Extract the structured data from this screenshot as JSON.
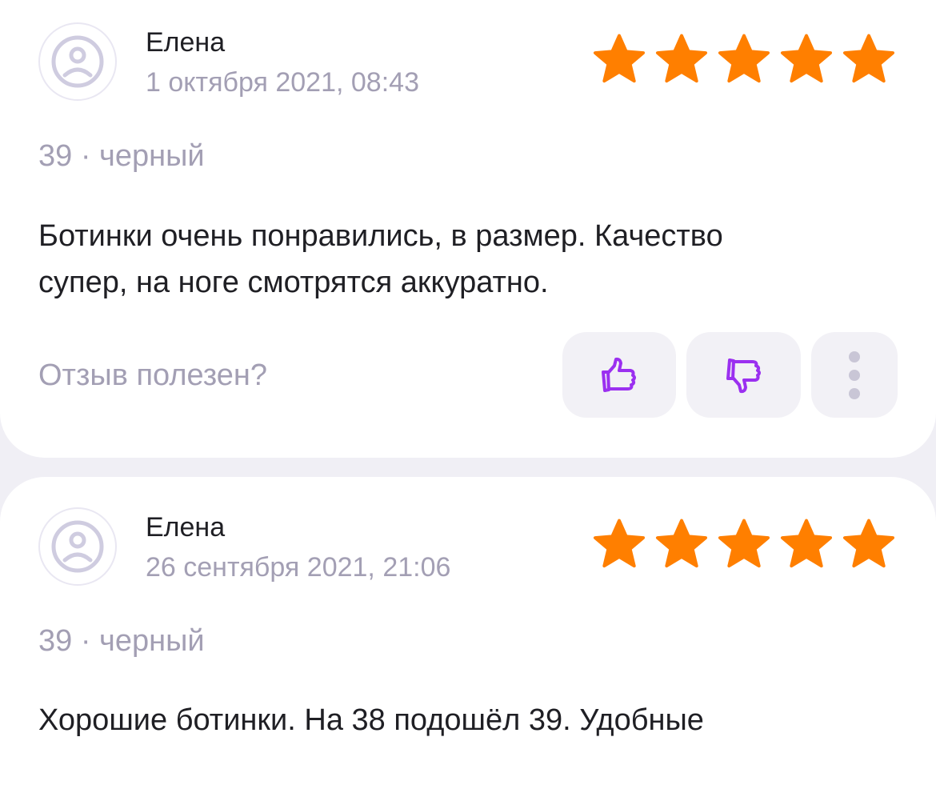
{
  "colors": {
    "star": "#ff7f00",
    "accent": "#9b30f0",
    "muted": "#a39fb4",
    "text": "#1f1f24"
  },
  "reviews": [
    {
      "author": "Елена",
      "date": "1 октября 2021, 08:43",
      "rating": 5,
      "variant": "39 · черный",
      "text_lines": [
        "Ботинки очень понравились, в размер. Качество",
        "супер, на ноге смотрятся аккуратно."
      ],
      "helpful_prompt": "Отзыв полезен?",
      "icons": {
        "avatar": "user-sad-face-icon",
        "like": "thumbs-up-icon",
        "dislike": "thumbs-down-icon",
        "more": "more-vertical-icon"
      }
    },
    {
      "author": "Елена",
      "date": "26 сентября 2021, 21:06",
      "rating": 5,
      "variant": "39 · черный",
      "text_lines": [
        "Хорошие ботинки. На 38 подошёл 39. Удобные"
      ],
      "icons": {
        "avatar": "user-sad-face-icon"
      }
    }
  ]
}
